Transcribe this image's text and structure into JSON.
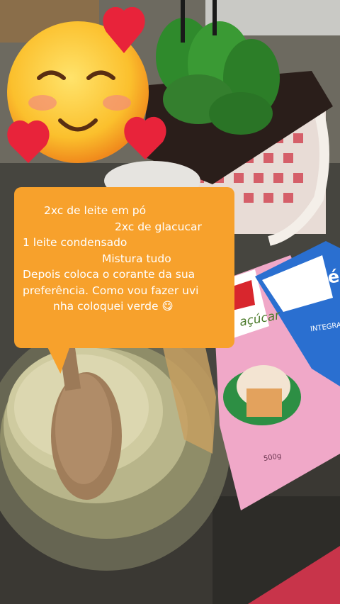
{
  "caption": {
    "lines": [
      "2xc de  leite em pó",
      "2xc de glacucar",
      "1 leite condensado",
      "Mistura tudo",
      "Depois coloca o corante da sua",
      "preferência. Como vou fazer uvi",
      "nha coloquei verde 😋"
    ]
  },
  "sticker": {
    "icon": "smiling-face-with-hearts-icon"
  },
  "packages": {
    "milk_brand": "itambé",
    "milk_variant": "INTEGRAL",
    "sugar_type": "açúcar",
    "sugar_weight": "500g"
  },
  "colors": {
    "bubble": "#f7a12c",
    "milk_bag": "#2a6fd0",
    "sugar_bag": "#f0a8c8",
    "leaf_green": "#2f8a2c"
  }
}
